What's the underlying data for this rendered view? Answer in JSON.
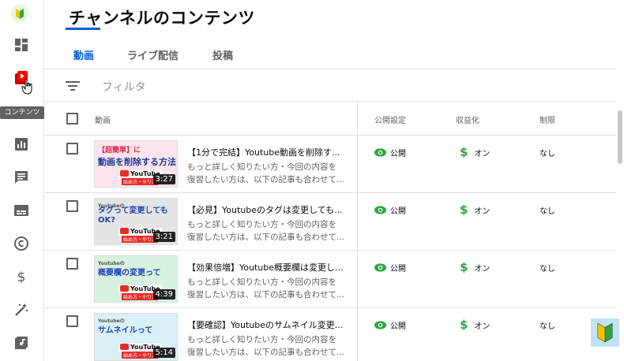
{
  "header": {
    "title": "チャンネルのコンテンツ"
  },
  "tabs": [
    {
      "label": "動画",
      "active": true
    },
    {
      "label": "ライブ配信",
      "active": false
    },
    {
      "label": "投稿",
      "active": false
    }
  ],
  "filter": {
    "placeholder": "フィルタ"
  },
  "sidebar": {
    "tooltip": "コンテンツ",
    "items": [
      "dashboard-icon",
      "content-icon",
      "analytics-icon",
      "comments-icon",
      "subtitles-icon",
      "copyright-icon",
      "monetization-icon",
      "customization-icon",
      "audio-library-icon"
    ]
  },
  "table": {
    "columns": {
      "video": "動画",
      "visibility": "公開設定",
      "monetization": "収益化",
      "restrictions": "制限"
    },
    "rows": [
      {
        "title": "【1分で完結】Youtube動画を削除す...",
        "desc1": "もっと詳しく知りたい方・今回の内容を",
        "desc2": "復習したい方は、以下の記事も合わせて...",
        "visibility": "公開",
        "monetization": "オン",
        "restrictions": "なし",
        "duration": "3:27",
        "thumb_banner": "【超簡単】に",
        "thumb_big": "動画を削除する方法",
        "thumb_yt": "YouTube",
        "thumb_sub": "始め方・やり方"
      },
      {
        "title": "【必見】Youtubeのタグは変更しても...",
        "desc1": "もっと詳しく知りたい方・今回の内容を",
        "desc2": "復習したい方は、以下の記事も合わせて...",
        "visibility": "公開",
        "monetization": "オン",
        "restrictions": "なし",
        "duration": "3:21",
        "thumb_banner": "Youtubeの",
        "thumb_big": "タグって変更してもOK?",
        "thumb_yt": "YouTube",
        "thumb_sub": "始め方・やり方"
      },
      {
        "title": "【効果倍増】Youtube概要欄は変更し...",
        "desc1": "もっと詳しく知りたい方・今回の内容を",
        "desc2": "復習したい方は、以下の記事も合わせて...",
        "visibility": "公開",
        "monetization": "オン",
        "restrictions": "なし",
        "duration": "4:39",
        "thumb_banner": "Youtubeの",
        "thumb_big": "概要欄の変更って",
        "thumb_yt": "YouTube",
        "thumb_sub": "始め方・やり方"
      },
      {
        "title": "【要確認】Youtubeのサムネイル変更...",
        "desc1": "もっと詳しく知りたい方・今回の内容を",
        "desc2": "復習したい方は、以下の記事も合わせて...",
        "visibility": "公開",
        "monetization": "オン",
        "restrictions": "なし",
        "duration": "5:14",
        "thumb_banner": "Youtubeの",
        "thumb_big": "サムネイルって",
        "thumb_yt": "YouTube",
        "thumb_sub": "始め方・やり方"
      }
    ]
  },
  "colors": {
    "accent": "#065fd4",
    "public_icon": "#2ba640",
    "money_icon": "#2ba640"
  }
}
